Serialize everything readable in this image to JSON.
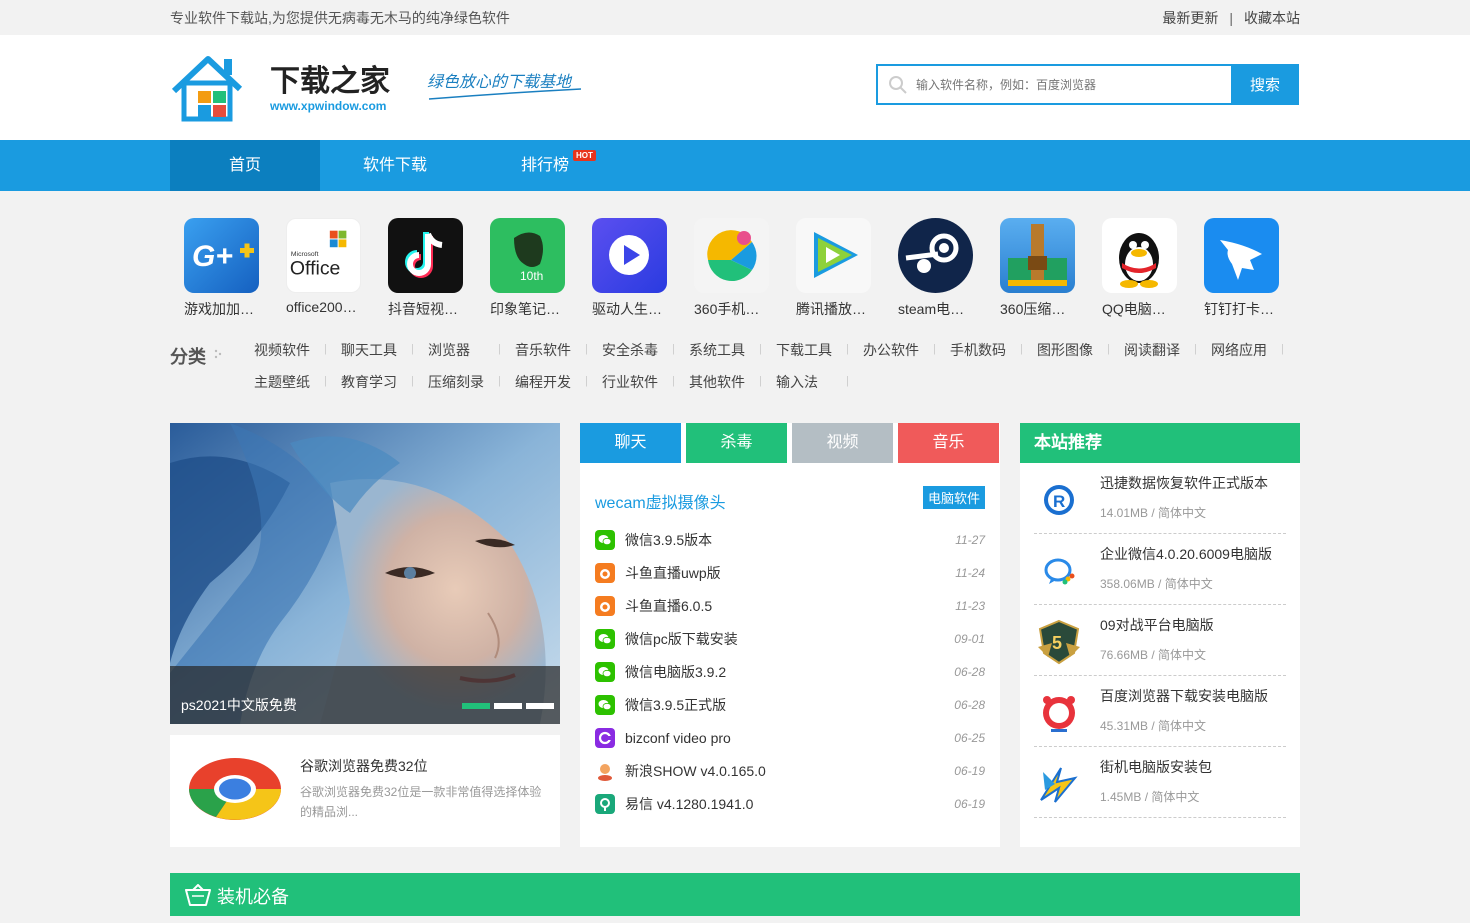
{
  "topbar": {
    "tagline": "专业软件下载站,为您提供无病毒无木马的纯净绿色软件",
    "links": [
      "最新更新",
      "收藏本站"
    ]
  },
  "logo": {
    "name": "下载之家",
    "url_text": "www.xpwindow.com",
    "slogan": "绿色放心的下载基地"
  },
  "search": {
    "placeholder": "输入软件名称，例如：百度浏览器",
    "button": "搜索"
  },
  "nav": {
    "items": [
      "首页",
      "软件下载",
      "排行榜"
    ],
    "hot_badge": "HOT"
  },
  "apps": [
    {
      "label": "游戏加加…",
      "icon": "gamepp-icon"
    },
    {
      "label": "office200…",
      "icon": "office-icon"
    },
    {
      "label": "抖音短视…",
      "icon": "douyin-icon"
    },
    {
      "label": "印象笔记…",
      "icon": "evernote-icon"
    },
    {
      "label": "驱动人生…",
      "icon": "drivergenius-icon"
    },
    {
      "label": "360手机…",
      "icon": "360mobile-icon"
    },
    {
      "label": "腾讯播放…",
      "icon": "tencentvideo-icon"
    },
    {
      "label": "steam电…",
      "icon": "steam-icon"
    },
    {
      "label": "360压缩…",
      "icon": "360zip-icon"
    },
    {
      "label": "QQ电脑…",
      "icon": "qq-icon"
    },
    {
      "label": "钉钉打卡…",
      "icon": "dingtalk-icon"
    }
  ],
  "categories": {
    "title": "分类",
    "row1": [
      "视频软件",
      "聊天工具",
      "浏览器",
      "音乐软件",
      "安全杀毒",
      "系统工具",
      "下载工具",
      "办公软件",
      "手机数码",
      "图形图像",
      "阅读翻译",
      "网络应用"
    ],
    "row2": [
      "主题壁纸",
      "教育学习",
      "压缩刻录",
      "编程开发",
      "行业软件",
      "其他软件",
      "输入法"
    ]
  },
  "banner": {
    "caption": "ps2021中文版免费"
  },
  "feature": {
    "title": "谷歌浏览器免费32位",
    "desc": "谷歌浏览器免费32位是一款非常值得选择体验的精品浏..."
  },
  "tabs": [
    {
      "label": "聊天",
      "color": "#1a9be0"
    },
    {
      "label": "杀毒",
      "color": "#21c07a"
    },
    {
      "label": "视频",
      "color": "#b4bec4"
    },
    {
      "label": "音乐",
      "color": "#f05a5a"
    }
  ],
  "chat": {
    "headline": "wecam虚拟摄像头",
    "tag": "电脑软件",
    "items": [
      {
        "title": "微信3.9.5版本",
        "date": "11-27",
        "icon": "wechat-icon"
      },
      {
        "title": "斗鱼直播uwp版",
        "date": "11-24",
        "icon": "douyu-icon"
      },
      {
        "title": "斗鱼直播6.0.5",
        "date": "11-23",
        "icon": "douyu-icon"
      },
      {
        "title": "微信pc版下载安装",
        "date": "09-01",
        "icon": "wechat-icon"
      },
      {
        "title": "微信电脑版3.9.2",
        "date": "06-28",
        "icon": "wechat-icon"
      },
      {
        "title": "微信3.9.5正式版",
        "date": "06-28",
        "icon": "wechat-icon"
      },
      {
        "title": "bizconf video pro",
        "date": "06-25",
        "icon": "bizconf-icon"
      },
      {
        "title": "新浪SHOW v4.0.165.0",
        "date": "06-19",
        "icon": "sinashow-icon"
      },
      {
        "title": "易信 v4.1280.1941.0",
        "date": "06-19",
        "icon": "yixin-icon"
      }
    ]
  },
  "recommend": {
    "title": "本站推荐",
    "items": [
      {
        "name": "迅捷数据恢复软件正式版本",
        "meta": "14.01MB / 简体中文",
        "icon": "recovery-icon"
      },
      {
        "name": "企业微信4.0.20.6009电脑版",
        "meta": "358.06MB / 简体中文",
        "icon": "wecom-icon"
      },
      {
        "name": "09对战平台电脑版",
        "meta": "76.66MB / 简体中文",
        "icon": "09battle-icon"
      },
      {
        "name": "百度浏览器下载安装电脑版",
        "meta": "45.31MB / 简体中文",
        "icon": "baidu-browser-icon"
      },
      {
        "name": "街机电脑版安装包",
        "meta": "1.45MB / 简体中文",
        "icon": "arcade-icon"
      }
    ]
  },
  "must": {
    "title": "装机必备"
  }
}
